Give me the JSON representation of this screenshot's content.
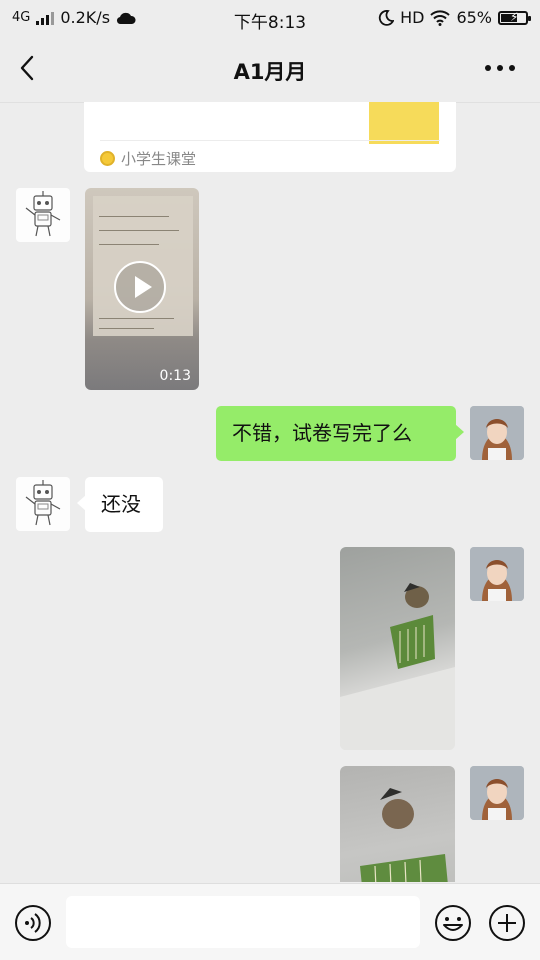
{
  "status_bar": {
    "network": "4G",
    "speed": "0.2K/s",
    "time": "下午8:13",
    "hd": "HD",
    "battery_percent": "65%",
    "battery_level": 0.65,
    "icons": [
      "signal-icon",
      "cloud-icon",
      "moon-icon",
      "wifi-icon",
      "battery-charging-icon"
    ]
  },
  "nav": {
    "title": "A1月月",
    "back_icon": "chevron-left-icon",
    "more_icon": "more-dots-icon"
  },
  "messages": [
    {
      "type": "link_card",
      "side": "in",
      "source": "小学生课堂",
      "source_icon": "mini-program-icon"
    },
    {
      "type": "video",
      "side": "in",
      "duration": "0:13"
    },
    {
      "type": "text",
      "side": "out",
      "text": "不错，试卷写完了么"
    },
    {
      "type": "text",
      "side": "in",
      "text": "还没"
    },
    {
      "type": "image",
      "side": "out"
    },
    {
      "type": "image",
      "side": "out"
    }
  ],
  "input_bar": {
    "placeholder": "",
    "icons": [
      "voice-icon",
      "emoji-icon",
      "plus-icon"
    ]
  },
  "colors": {
    "out_bubble": "#95ec69",
    "in_bubble": "#ffffff",
    "background": "#ededed"
  }
}
